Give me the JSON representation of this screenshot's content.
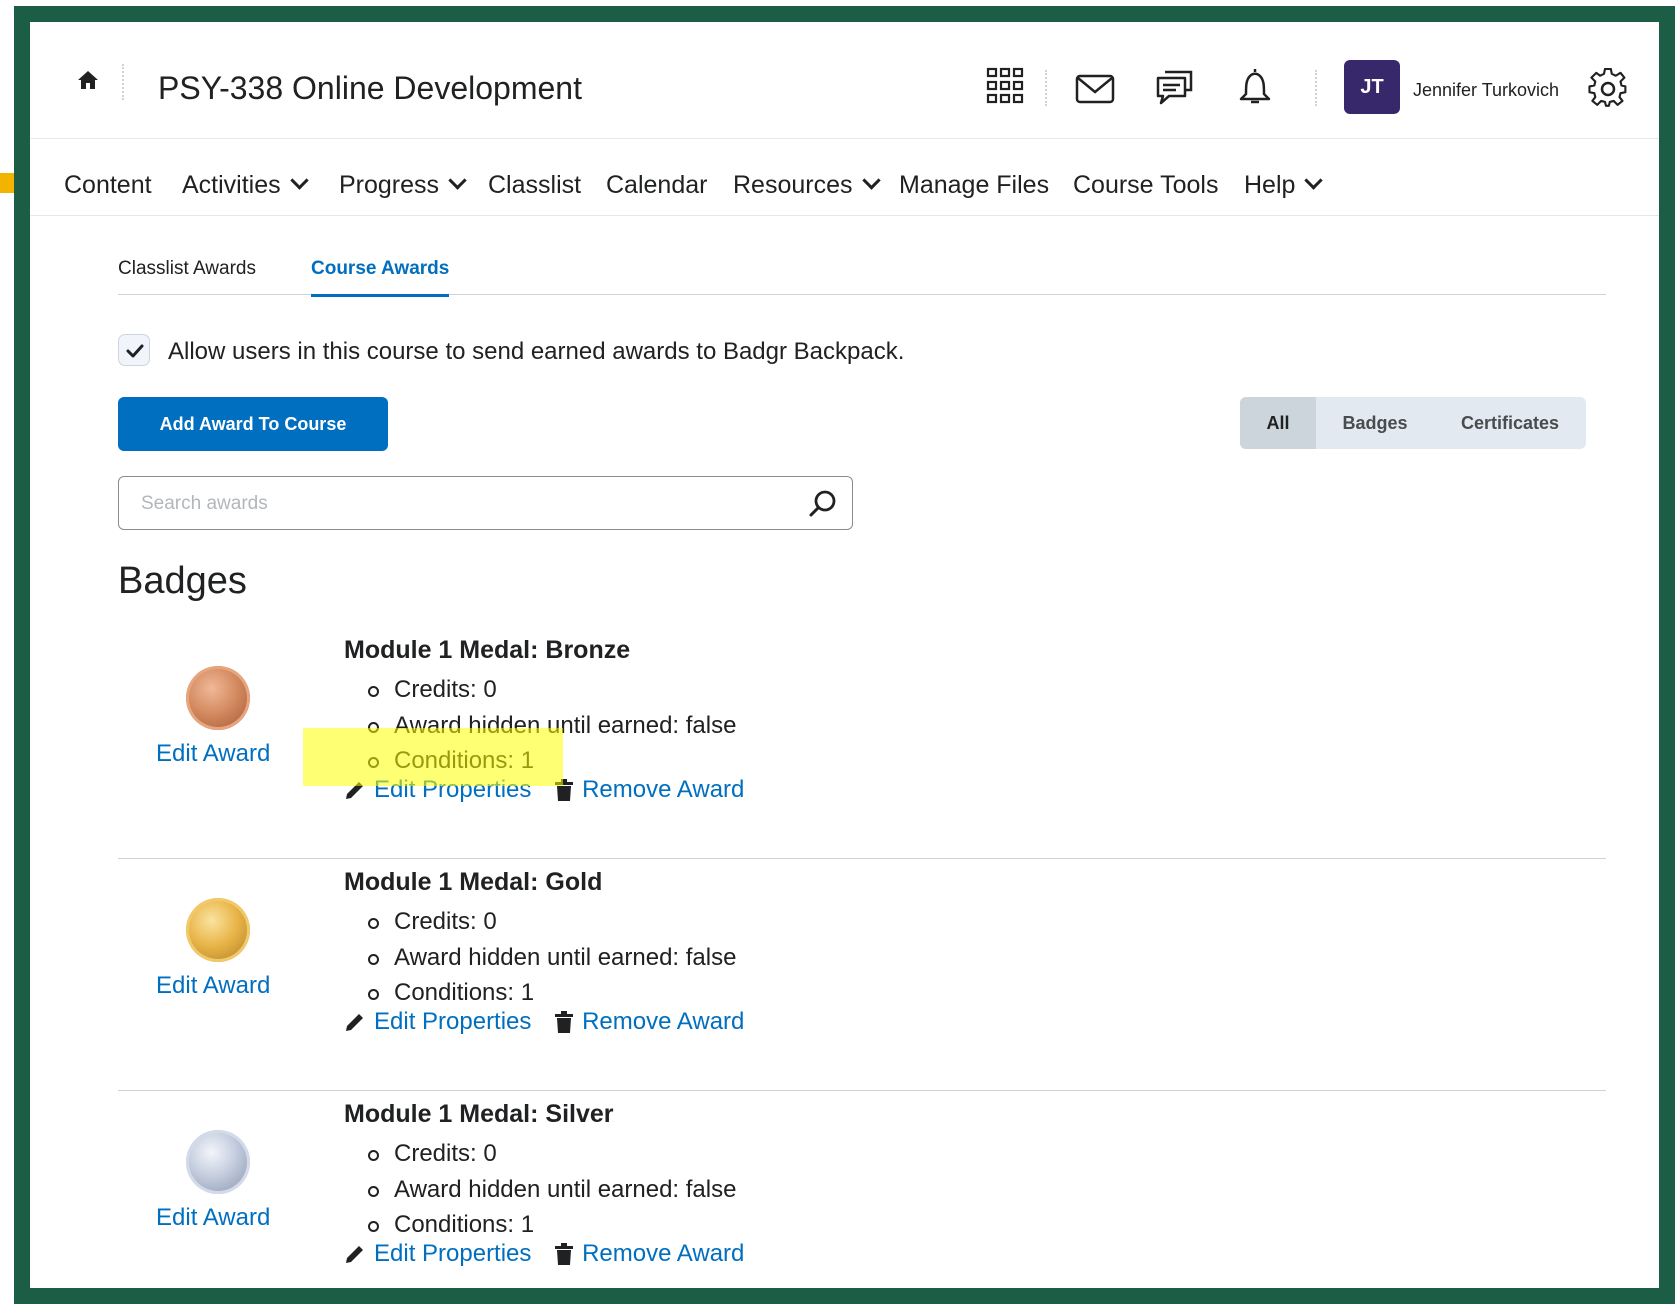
{
  "header": {
    "course_title": "PSY-338 Online Development",
    "user_initials": "JT",
    "user_name": "Jennifer Turkovich"
  },
  "nav": {
    "items": [
      {
        "label": "Content",
        "dropdown": false
      },
      {
        "label": "Activities",
        "dropdown": true
      },
      {
        "label": "Progress",
        "dropdown": true
      },
      {
        "label": "Classlist",
        "dropdown": false
      },
      {
        "label": "Calendar",
        "dropdown": false
      },
      {
        "label": "Resources",
        "dropdown": true
      },
      {
        "label": "Manage Files",
        "dropdown": false
      },
      {
        "label": "Course Tools",
        "dropdown": false
      },
      {
        "label": "Help",
        "dropdown": true
      }
    ]
  },
  "tabs": {
    "classlist": "Classlist Awards",
    "course": "Course Awards",
    "active": "Course Awards"
  },
  "options": {
    "badgr_label": "Allow users in this course to send earned awards to Badgr Backpack.",
    "badgr_checked": true
  },
  "toolbar": {
    "add_button": "Add Award To Course",
    "filter_all": "All",
    "filter_badges": "Badges",
    "filter_certificates": "Certificates",
    "filter_selected": "All"
  },
  "search": {
    "placeholder": "Search awards",
    "value": ""
  },
  "section": {
    "title": "Badges"
  },
  "awards": [
    {
      "title": "Module 1 Medal: Bronze",
      "credits": "Credits: 0",
      "hidden": "Award hidden until earned: false",
      "conditions": "Conditions: 1",
      "edit_award": "Edit Award",
      "edit_properties": "Edit Properties",
      "remove_award": "Remove Award",
      "medal_color": "#c77a4f"
    },
    {
      "title": "Module 1 Medal: Gold",
      "credits": "Credits: 0",
      "hidden": "Award hidden until earned: false",
      "conditions": "Conditions: 1",
      "edit_award": "Edit Award",
      "edit_properties": "Edit Properties",
      "remove_award": "Remove Award",
      "medal_color": "#e0a93a"
    },
    {
      "title": "Module 1 Medal: Silver",
      "credits": "Credits: 0",
      "hidden": "Award hidden until earned: false",
      "conditions": "Conditions: 1",
      "edit_award": "Edit Award",
      "edit_properties": "Edit Properties",
      "remove_award": "Remove Award",
      "medal_color": "#b7c2d6"
    }
  ],
  "colors": {
    "frame": "#1b5e45",
    "link": "#006fbf",
    "avatar": "#37286b",
    "highlight": "#ffff00"
  }
}
